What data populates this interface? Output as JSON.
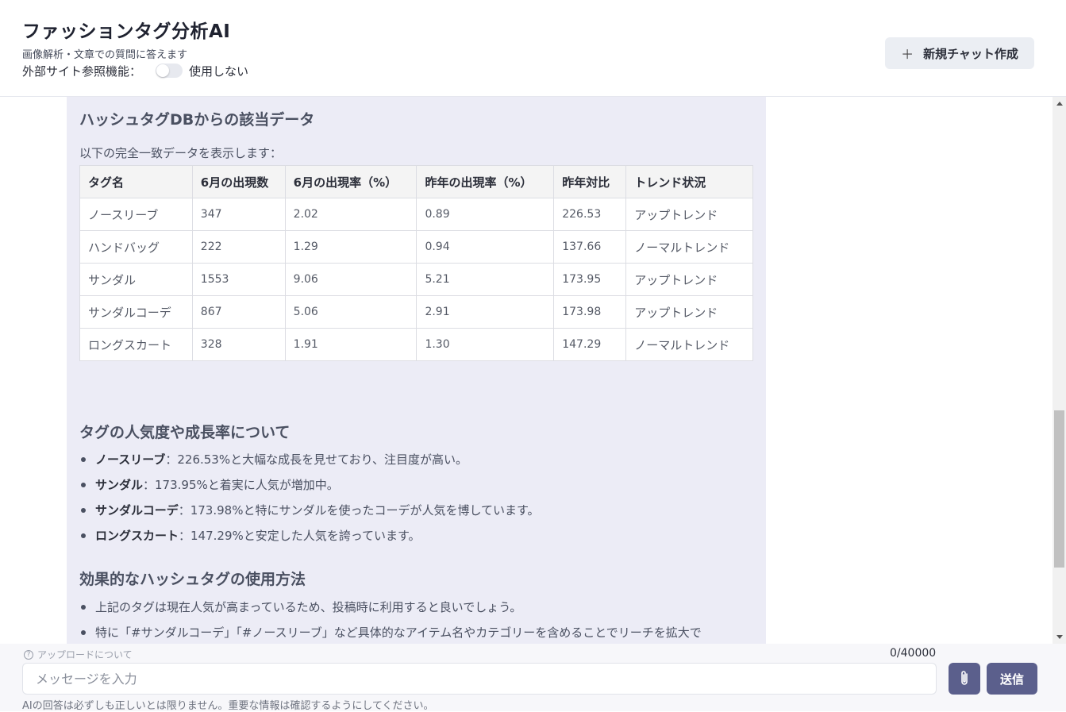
{
  "header": {
    "title": "ファッションタグ分析AI",
    "subtitle": "画像解析・文章での質問に答えます",
    "external_label": "外部サイト参照機能：",
    "external_toggle_state": "使用しない",
    "new_chat_icon": "plus-icon",
    "new_chat_label": "新規チャット作成"
  },
  "message": {
    "db_heading": "ハッシュタグDBからの該当データ",
    "intro": "以下の完全一致データを表示します：",
    "table": {
      "headers": [
        "タグ名",
        "6月の出現数",
        "6月の出現率（%）",
        "昨年の出現率（%）",
        "昨年対比",
        "トレンド状況"
      ],
      "rows": [
        [
          "ノースリーブ",
          "347",
          "2.02",
          "0.89",
          "226.53",
          "アップトレンド"
        ],
        [
          "ハンドバッグ",
          "222",
          "1.29",
          "0.94",
          "137.66",
          "ノーマルトレンド"
        ],
        [
          "サンダル",
          "1553",
          "9.06",
          "5.21",
          "173.95",
          "アップトレンド"
        ],
        [
          "サンダルコーデ",
          "867",
          "5.06",
          "2.91",
          "173.98",
          "アップトレンド"
        ],
        [
          "ロングスカート",
          "328",
          "1.91",
          "1.30",
          "147.29",
          "ノーマルトレンド"
        ]
      ]
    },
    "popularity_heading": "タグの人気度や成長率について",
    "popularity_items": [
      {
        "name": "ノースリーブ",
        "text": "：226.53%と大幅な成長を見せており、注目度が高い。"
      },
      {
        "name": "サンダル",
        "text": "：173.95%と着実に人気が増加中。"
      },
      {
        "name": "サンダルコーデ",
        "text": "：173.98%と特にサンダルを使ったコーデが人気を博しています。"
      },
      {
        "name": "ロングスカート",
        "text": "：147.29%と安定した人気を誇っています。"
      }
    ],
    "usage_heading": "効果的なハッシュタグの使用方法",
    "usage_items": [
      "上記のタグは現在人気が高まっているため、投稿時に利用すると良いでしょう。",
      "特に「#サンダルコーデ」「#ノースリーブ」など具体的なアイテム名やカテゴリーを含めることでリーチを拡大で"
    ]
  },
  "footer": {
    "upload_info_icon": "question-circle-icon",
    "upload_info": "アップロードについて",
    "counter": "0/40000",
    "input_placeholder": "メッセージを入力",
    "attach_icon": "paperclip-icon",
    "send_label": "送信",
    "disclaimer": "AIの回答は必ずしも正しいとは限りません。重要な情報は確認するようにしてください。"
  },
  "colors": {
    "accent": "#5b5f8c",
    "bubble_bg": "#ececf6",
    "button_bg": "#ebeef3"
  }
}
